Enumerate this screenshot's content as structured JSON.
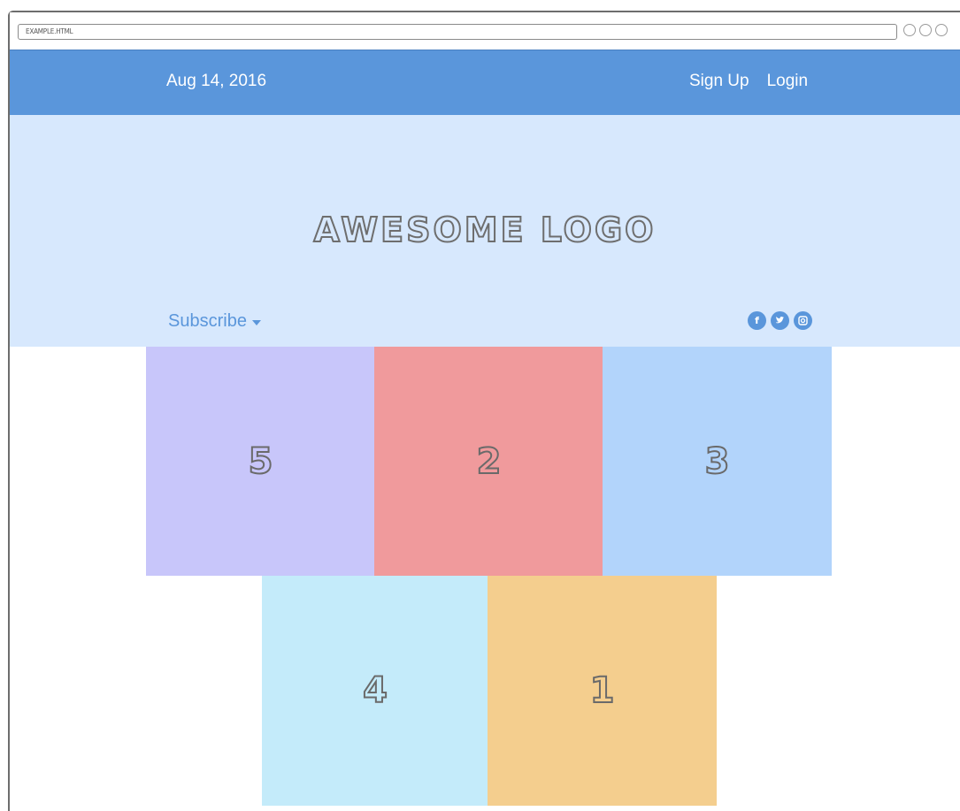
{
  "browser": {
    "url": "EXAMPLE.HTML"
  },
  "header": {
    "date": "Aug 14, 2016",
    "nav": [
      {
        "label": "Sign Up"
      },
      {
        "label": "Login"
      }
    ]
  },
  "hero": {
    "logo": "AWESOME LOGO",
    "subscribe_label": "Subscribe",
    "social": [
      {
        "name": "facebook-icon",
        "glyph": "f"
      },
      {
        "name": "twitter-icon",
        "glyph": "t"
      },
      {
        "name": "instagram-icon",
        "glyph": "◙"
      }
    ]
  },
  "tiles": [
    {
      "label": "5",
      "color": "#c8c6fa"
    },
    {
      "label": "2",
      "color": "#f09a9c"
    },
    {
      "label": "3",
      "color": "#b2d4fb"
    },
    {
      "label": "4",
      "color": "#c4ebfa"
    },
    {
      "label": "1",
      "color": "#f4ce8e"
    }
  ],
  "colors": {
    "topbar": "#5a96db",
    "hero_bg": "#d7e8fd",
    "accent": "#5a96db"
  }
}
